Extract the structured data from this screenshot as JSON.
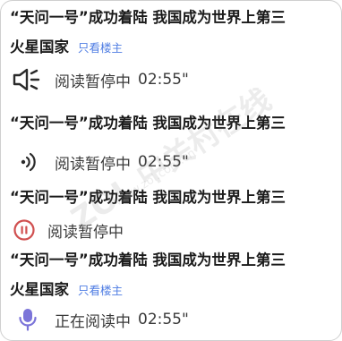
{
  "blocks": [
    {
      "title": "“天问一号”成功着陆 我国成为世界上第三",
      "author": "火星国家",
      "op_link": "只看楼主",
      "icon": "speaker-icon",
      "status_label": "阅读暂停中",
      "status_time": "02:55\""
    },
    {
      "title": "“天问一号”成功着陆 我国成为世界上第三",
      "icon": "sound-wave-icon",
      "status_label": "阅读暂停中",
      "status_time": "02:55\""
    },
    {
      "title": "“天问一号”成功着陆 我国成为世界上第三",
      "icon": "pause-circle-icon",
      "status_label": "阅读暂停中",
      "status_time": ""
    },
    {
      "title": "“天问一号”成功着陆 我国成为世界上第三",
      "author": "火星国家",
      "op_link": "只看楼主",
      "icon": "microphone-icon",
      "status_label": "正在阅读中",
      "status_time": "02:55\""
    }
  ],
  "colors": {
    "link": "#4f7de3",
    "pause_icon": "#d05050",
    "mic_icon": "#7b74d9"
  },
  "watermark": {
    "main": "ZOL 中关村在线",
    "sub": "www.zol.com.cn"
  }
}
